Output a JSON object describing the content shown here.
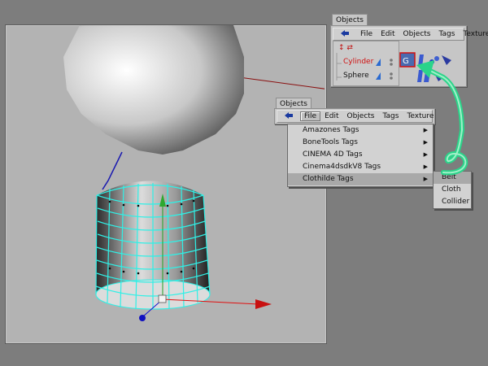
{
  "objects_panel_top": {
    "tab": "Objects",
    "menu": [
      "File",
      "Edit",
      "Objects",
      "Tags",
      "Texture"
    ],
    "rows": [
      {
        "name": "Cylinder",
        "color": "#d01010"
      },
      {
        "name": "Sphere",
        "color": "#111111"
      }
    ]
  },
  "objects_panel_menu": {
    "tab": "Objects",
    "menu": [
      "File",
      "Edit",
      "Objects",
      "Tags",
      "Texture"
    ],
    "active_menu": "File"
  },
  "file_dropdown": {
    "items": [
      "Amazones Tags",
      "BoneTools Tags",
      "CINEMA 4D Tags",
      "Cinema4dsdkV8 Tags",
      "Clothilde Tags"
    ],
    "selected": "Clothilde Tags"
  },
  "submenu": {
    "items": [
      "Belt",
      "Cloth",
      "Collider"
    ],
    "selected": "Belt"
  },
  "colors": {
    "wire": "#2ff0e6",
    "annotation": "#2bd48a",
    "axis_x": "#e01010",
    "axis_y": "#20a020",
    "axis_z": "#1010d0"
  }
}
